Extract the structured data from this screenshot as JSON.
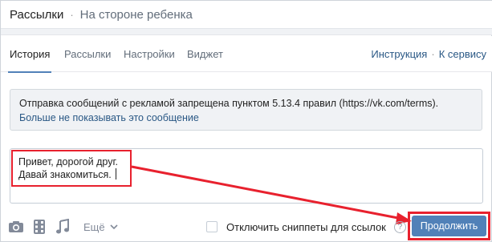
{
  "header": {
    "title": "Рассылки",
    "separator": "·",
    "subtitle": "На стороне ребенка"
  },
  "tabs": [
    {
      "label": "История",
      "active": true
    },
    {
      "label": "Рассылки",
      "active": false
    },
    {
      "label": "Настройки",
      "active": false
    },
    {
      "label": "Виджет",
      "active": false
    }
  ],
  "links": {
    "instruction": "Инструкция",
    "separator": "·",
    "to_service": "К сервису"
  },
  "notice": {
    "message": "Отправка сообщений с рекламой запрещена пунктом 5.13.4 правил (",
    "link": "https://vk.com/terms",
    "message_end": ").",
    "dismiss": "Больше не показывать это сообщение"
  },
  "compose": {
    "line1": "Привет, дорогой друг.",
    "line2": "Давай знакомиться."
  },
  "toolbar": {
    "icons": [
      "camera-icon",
      "video-icon",
      "music-icon"
    ],
    "more_label": "Ещё",
    "disable_snippets_label": "Отключить сниппеты для ссылок",
    "disable_snippets_checked": false,
    "help_label": "?",
    "continue_label": "Продолжить"
  },
  "colors": {
    "accent": "#5181b8",
    "link": "#2a5885",
    "highlight": "#e8212e"
  }
}
